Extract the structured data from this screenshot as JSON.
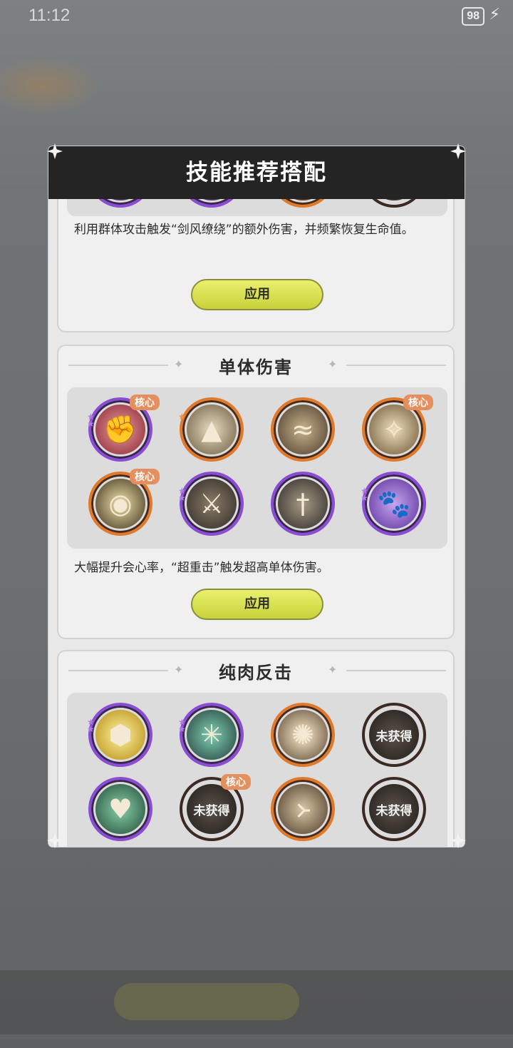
{
  "status": {
    "time": "11:12",
    "battery": "98",
    "bolt": "⚡"
  },
  "dialog": {
    "title": "技能推荐搭配"
  },
  "sections": [
    {
      "desc": "利用群体攻击触发“剑风缭绕”的额外伤害，并频繁恢复生命值。",
      "apply_label": "应用"
    },
    {
      "title": "单体伤害",
      "desc": "大幅提升会心率，“超重击”触发超高单体伤害。",
      "apply_label": "应用",
      "skills": [
        {
          "frame": "purple",
          "core": "核心",
          "icon": "strike-icon"
        },
        {
          "frame": "orange",
          "icon": "spike-icon"
        },
        {
          "frame": "orange",
          "icon": "wind-icon"
        },
        {
          "frame": "orange",
          "core": "核心",
          "icon": "sword-icon"
        },
        {
          "frame": "orange",
          "core": "核心",
          "icon": "eye-icon"
        },
        {
          "frame": "purple",
          "icon": "sword-up-icon"
        },
        {
          "frame": "purple",
          "icon": "sword-down-icon"
        },
        {
          "frame": "purple",
          "icon": "beast-icon"
        }
      ]
    },
    {
      "title": "纯肉反击",
      "skills": [
        {
          "frame": "purple",
          "icon": "shield-icon"
        },
        {
          "frame": "purple",
          "icon": "web-icon"
        },
        {
          "frame": "orange",
          "icon": "burst-icon"
        },
        {
          "frame": "dark",
          "locked": "未获得"
        },
        {
          "frame": "purple",
          "icon": "heart-icon"
        },
        {
          "frame": "dark",
          "core": "核心",
          "locked": "未获得"
        },
        {
          "frame": "orange",
          "icon": "rune-icon"
        },
        {
          "frame": "dark",
          "locked": "未获得"
        }
      ]
    }
  ]
}
